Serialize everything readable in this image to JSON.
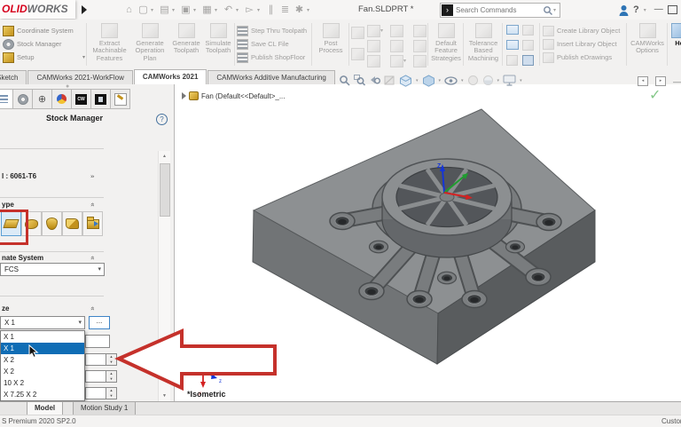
{
  "titlebar": {
    "logo_red": "OLID",
    "logo_gray": "WORKS",
    "filename": "Fan.SLDPRT *",
    "search_placeholder": "Search Commands",
    "help": "?"
  },
  "ribbon": {
    "left_items": [
      {
        "label": "Coordinate System"
      },
      {
        "label": "Stock Manager"
      },
      {
        "label": "Setup"
      }
    ],
    "big": [
      {
        "label": "Extract Machinable Features"
      },
      {
        "label": "Generate Operation Plan"
      },
      {
        "label": "Generate Toolpath"
      },
      {
        "label": "Simulate Toolpath"
      }
    ],
    "toolpath_items": [
      {
        "label": "Step Thru Toolpath"
      },
      {
        "label": "Save CL File"
      },
      {
        "label": "Publish ShopFloor"
      }
    ],
    "post_process": "Post Process",
    "default_feature": "Default Feature Strategies",
    "tolerance": "Tolerance Based Machining",
    "library_items": [
      {
        "label": "Create Library Object"
      },
      {
        "label": "Insert Library Object"
      },
      {
        "label": "Publish eDrawings"
      }
    ],
    "camworks_options": "CAMWorks Options",
    "help": "He"
  },
  "tabs": [
    {
      "label": "Sketch"
    },
    {
      "label": "CAMWorks 2021-WorkFlow"
    },
    {
      "label": "CAMWorks 2021"
    },
    {
      "label": "CAMWorks Additive Manufacturing"
    }
  ],
  "panel": {
    "title": "Stock Manager",
    "help": "?",
    "material_label": "l : 6061-T6",
    "type_label": "ype",
    "coord_label": "nate System",
    "coord_value": "FCS",
    "size_label": "ze",
    "size_value": "X 1",
    "browse": "...",
    "size_options": [
      {
        "label": "X 1"
      },
      {
        "label": "X 1"
      },
      {
        "label": "X 2"
      },
      {
        "label": "X 2"
      },
      {
        "label": "10 X 2"
      },
      {
        "label": "X 7.25 X 2"
      }
    ]
  },
  "viewport": {
    "tree_label": "Fan (Default<<Default>_...",
    "iso_label": "*Isometric",
    "hub_triad": {
      "z": "Z"
    },
    "corner_triad": {
      "x": "x",
      "y": "y",
      "z": "z"
    }
  },
  "bottom": {
    "tabs": [
      {
        "label": "Model"
      },
      {
        "label": "Motion Study 1"
      }
    ],
    "status_left": "S Premium 2020 SP2.0",
    "status_right": "Custom"
  },
  "colors": {
    "selection_blue": "#0f6db5",
    "annotation_red": "#c5312b",
    "stock_gold": "#d8a92f",
    "focus_border": "#3f84c6"
  }
}
